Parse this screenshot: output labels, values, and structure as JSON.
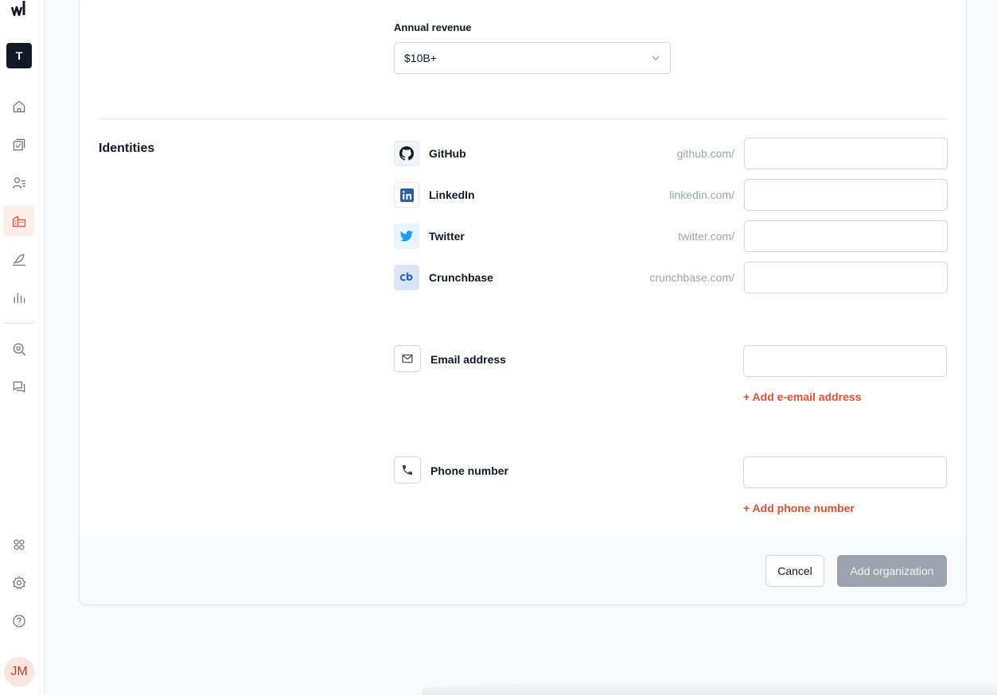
{
  "sidebar": {
    "workspace_initial": "T",
    "user_initials": "JM",
    "icons": [
      "home-icon",
      "tasks-icon",
      "contacts-icon",
      "organizations-icon",
      "opportunities-icon",
      "analytics-icon",
      "search-icon",
      "conversations-icon",
      "integrations-icon",
      "settings-icon",
      "help-icon"
    ],
    "active_item": "organizations",
    "accent_color": "#e94f2e"
  },
  "form": {
    "annual_revenue": {
      "label": "Annual revenue",
      "value": "$10B+"
    },
    "identities": {
      "title": "Identities",
      "platforms": [
        {
          "name": "GitHub",
          "prefix": "github.com/",
          "value": ""
        },
        {
          "name": "LinkedIn",
          "prefix": "linkedin.com/",
          "value": ""
        },
        {
          "name": "Twitter",
          "prefix": "twitter.com/",
          "value": ""
        },
        {
          "name": "Crunchbase",
          "prefix": "crunchbase.com/",
          "value": ""
        }
      ],
      "email": {
        "label": "Email address",
        "value": "",
        "add_label": "+ Add e-email address"
      },
      "phone": {
        "label": "Phone number",
        "value": "",
        "add_label": "+ Add phone number"
      }
    }
  },
  "footer": {
    "cancel_label": "Cancel",
    "submit_label": "Add organization"
  }
}
